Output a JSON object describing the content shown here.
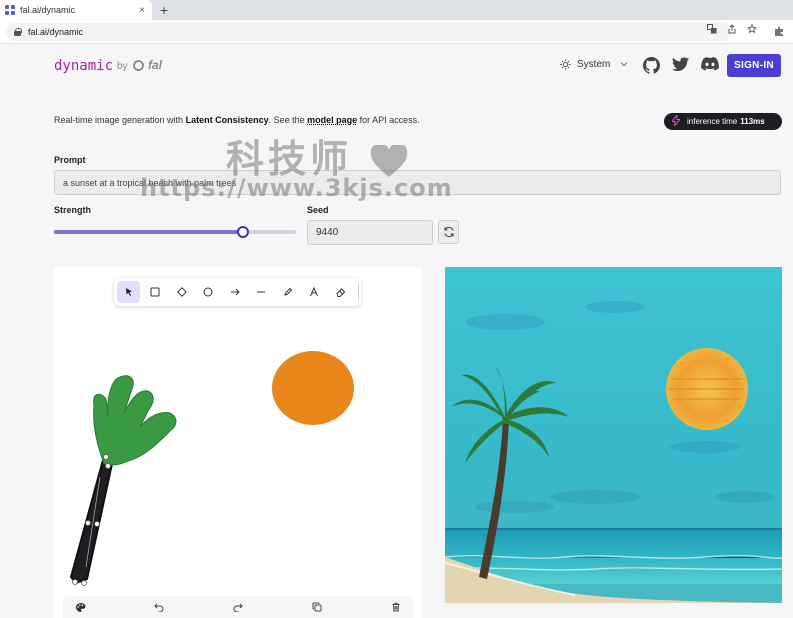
{
  "browser": {
    "tab_title": "fal.ai/dynamic",
    "tab_close": "×",
    "new_tab": "+",
    "url": "fal.ai/dynamic"
  },
  "header": {
    "logo": "dynamic",
    "by": "by",
    "fal": "fal",
    "theme": "System",
    "signin": "SIGN-IN"
  },
  "info": {
    "desc_prefix": "Real-time image generation with ",
    "desc_bold": "Latent Consistency",
    "desc_mid": ". See the ",
    "desc_link": "model page",
    "desc_suffix": " for API access.",
    "inference_label": "inference time",
    "inference_value": "113ms"
  },
  "form": {
    "prompt_label": "Prompt",
    "prompt_value": "a sunset at a tropical beach with palm trees",
    "strength_label": "Strength",
    "strength_value": 0.78,
    "seed_label": "Seed",
    "seed_value": "9440"
  },
  "watermark": {
    "line1": "科技师",
    "line2": "https://www.3kjs.com"
  },
  "colors": {
    "accent": "#4b3fd1",
    "logo": "#a0259c",
    "palm_green": "#3a9a44",
    "sun_orange": "#e8861c"
  },
  "icons": {
    "toolbar": [
      "select-icon",
      "rectangle-icon",
      "diamond-icon",
      "ellipse-icon",
      "arrow-icon",
      "line-icon",
      "pencil-icon",
      "text-icon",
      "eraser-icon"
    ],
    "bottombar": [
      "palette-icon",
      "undo-icon",
      "redo-icon",
      "duplicate-icon",
      "trash-icon"
    ]
  }
}
